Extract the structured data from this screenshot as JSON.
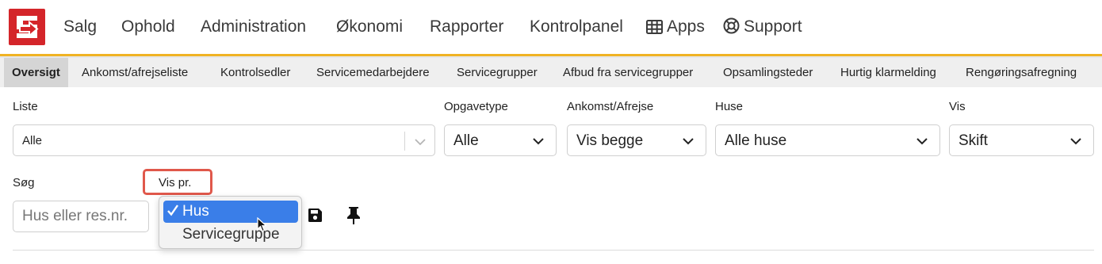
{
  "brand": {
    "logo_color": "#d4252a",
    "accent_color": "#f0b323"
  },
  "topnav": {
    "items": [
      {
        "label": "Salg"
      },
      {
        "label": "Ophold"
      },
      {
        "label": "Administration"
      },
      {
        "label": "Økonomi"
      },
      {
        "label": "Rapporter"
      },
      {
        "label": "Kontrolpanel"
      },
      {
        "label": "Apps",
        "icon": "grid-icon"
      },
      {
        "label": "Support",
        "icon": "lifebuoy-icon"
      }
    ]
  },
  "subnav": {
    "items": [
      {
        "label": "Oversigt",
        "active": true
      },
      {
        "label": "Ankomst/afrejseliste"
      },
      {
        "label": "Kontrolsedler"
      },
      {
        "label": "Servicemedarbejdere"
      },
      {
        "label": "Servicegrupper"
      },
      {
        "label": "Afbud fra servicegrupper"
      },
      {
        "label": "Opsamlingsteder"
      },
      {
        "label": "Hurtig klarmelding"
      },
      {
        "label": "Rengøringsafregning"
      }
    ]
  },
  "filters": {
    "liste": {
      "label": "Liste",
      "value": "Alle"
    },
    "opgavetype": {
      "label": "Opgavetype",
      "value": "Alle"
    },
    "ankomst": {
      "label": "Ankomst/Afrejse",
      "value": "Vis begge"
    },
    "huse": {
      "label": "Huse",
      "value": "Alle huse"
    },
    "vis": {
      "label": "Vis",
      "value": "Skift"
    }
  },
  "search": {
    "label": "Søg",
    "placeholder": "Hus eller res.nr."
  },
  "vis_pr": {
    "label": "Vis pr.",
    "options": [
      {
        "label": "Hus",
        "selected": true
      },
      {
        "label": "Servicegruppe",
        "selected": false
      }
    ]
  },
  "toolbar": {
    "icons": [
      "save-icon",
      "pin-icon"
    ]
  }
}
